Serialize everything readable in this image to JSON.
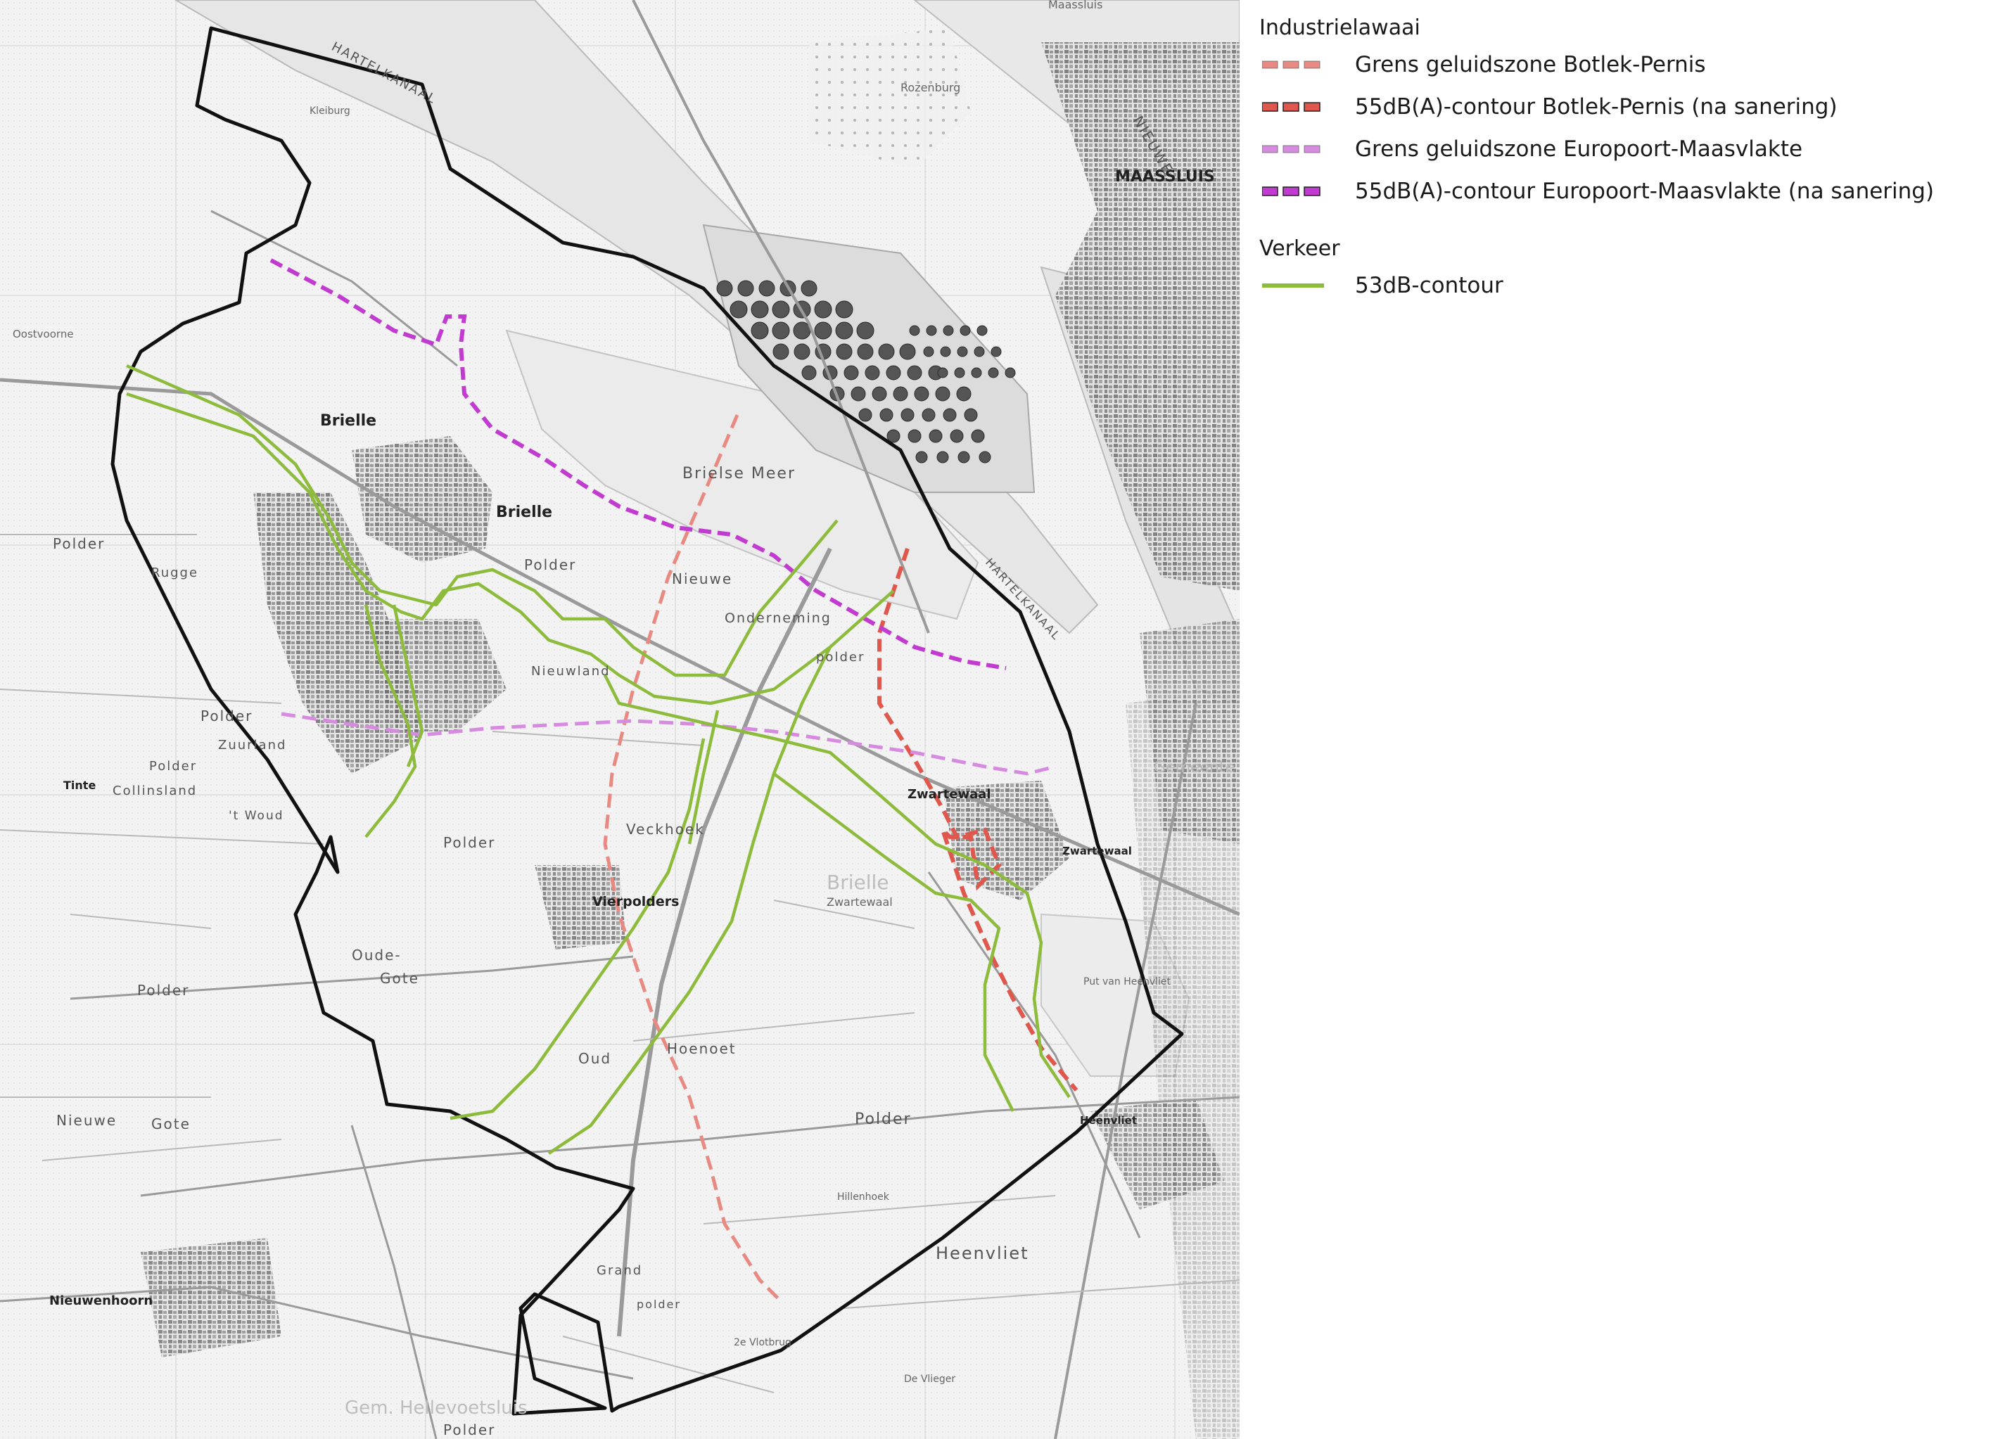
{
  "legend": {
    "industry_heading": "Industrielawaai",
    "traffic_heading": "Verkeer",
    "items": [
      {
        "label": "Grens geluidszone Botlek-Pernis",
        "color": "#e88a82",
        "style": "dashed-light"
      },
      {
        "label": "55dB(A)-contour Botlek-Pernis (na sanering)",
        "color": "#e0574d",
        "style": "dashed-bold"
      },
      {
        "label": "Grens geluidszone Europoort-Maasvlakte",
        "color": "#d68ae0",
        "style": "dashed-light"
      },
      {
        "label": "55dB(A)-contour Europoort-Maasvlakte (na sanering)",
        "color": "#c23bd1",
        "style": "dashed-bold"
      }
    ],
    "traffic_items": [
      {
        "label": "53dB-contour",
        "color": "#8dbb3c",
        "style": "solid"
      }
    ]
  },
  "map": {
    "places": {
      "maassluis_town": "Maassluis",
      "maassluis_large": "MAASSLUIS",
      "brielle_1": "Brielle",
      "brielle_2": "Brielle",
      "brielle_faint": "Brielle",
      "zwartewaal": "Zwartewaal",
      "zwartewaal_2": "Zwartewaal",
      "zwartewaal_small": "Zwartewaal",
      "vierpolders": "Vierpolders",
      "heenvliet": "Heenvliet",
      "heenvliet_area": "Heenvliet",
      "nieuwenhoorn": "Nieuwenhoorn",
      "tinte": "Tinte",
      "oostvoorne": "Oostvoorne",
      "rozenburg": "Rozenburg",
      "gemeente_faint": "Gemeente",
      "gem_hellevoetsluis": "Gem. Hellevoetsluis"
    },
    "areas": {
      "hartelkanaal_top": "HARTELKANAAL",
      "hartelkanaal_mid": "HARTELKANAAL",
      "nieuwe_waterweg": "NIEUWE",
      "brielse_meer": "Brielse Meer",
      "polder_1": "Polder",
      "polder_2": "Polder",
      "polder_3": "Polder",
      "polder_4": "Polder",
      "polder_5": "Polder",
      "polder_6": "Polder",
      "polder_7": "Polder",
      "polder_8": "polder",
      "polder_9": "polder",
      "rugge": "Rugge",
      "nieuwe_1": "Nieuwe",
      "nieuwe_2": "Nieuwe",
      "onderneming": "Onderneming",
      "nieuwland": "Nieuwland",
      "zuurland": "Zuurland",
      "collinsland": "Collinsland",
      "t_woud": "'t Woud",
      "veckhoek": "Veckhoek",
      "oude": "Oude-",
      "gote_1": "Gote",
      "gote_2": "Gote",
      "oud": "Oud",
      "hoenoet": "Hoenoet",
      "grand": "Grand",
      "vlotbrug": "2e Vlotbrug",
      "put_van_heenvliet": "Put van Heenvliet",
      "polder_bottom": "Polder",
      "kleiburg": "Kleiburg",
      "oostvoorne_small": "Oostvoorne",
      "de_vlieger": "De Vlieger",
      "hillenhoek": "Hillenhoek"
    }
  }
}
